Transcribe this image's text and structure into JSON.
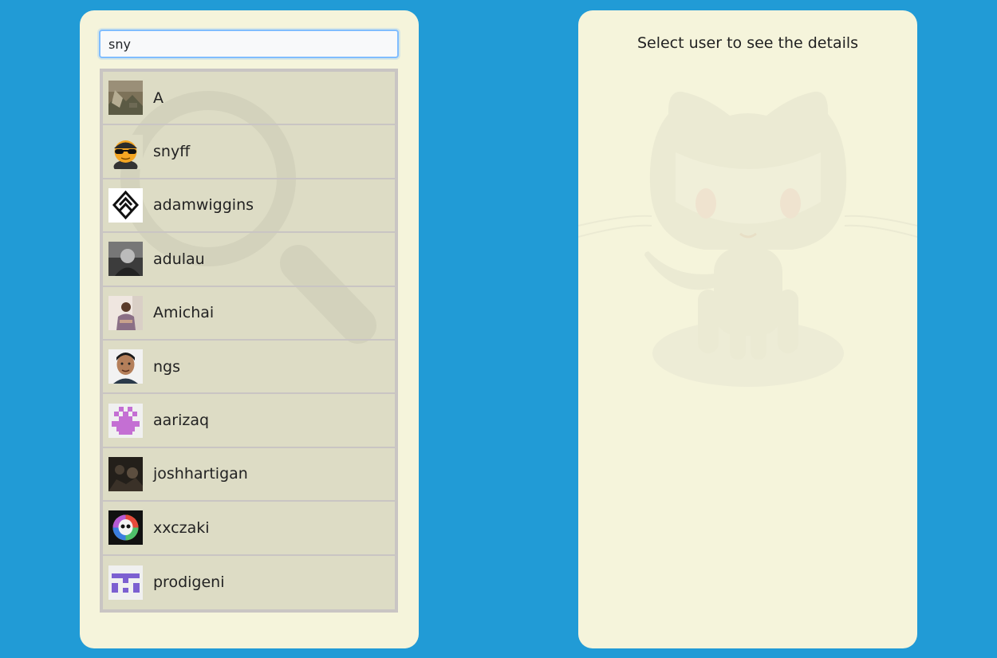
{
  "search": {
    "value": "sny",
    "placeholder": ""
  },
  "users": [
    {
      "login": "A",
      "avatar": "photo-landscape"
    },
    {
      "login": "snyff",
      "avatar": "emoji-sunglasses"
    },
    {
      "login": "adamwiggins",
      "avatar": "logo-diamond"
    },
    {
      "login": "adulau",
      "avatar": "photo-grayscale"
    },
    {
      "login": "Amichai",
      "avatar": "photo-person"
    },
    {
      "login": "ngs",
      "avatar": "photo-face"
    },
    {
      "login": "aarizaq",
      "avatar": "identicon-pink"
    },
    {
      "login": "joshhartigan",
      "avatar": "photo-dark"
    },
    {
      "login": "xxczaki",
      "avatar": "rainbow-skull"
    },
    {
      "login": "prodigeni",
      "avatar": "identicon-purple"
    }
  ],
  "details": {
    "prompt": "Select user to see the details"
  },
  "colors": {
    "background": "#219bd6",
    "panel": "#f5f4db",
    "list": "#dddcc5",
    "list_border": "#c9c5c3",
    "focus": "#80bdff"
  }
}
